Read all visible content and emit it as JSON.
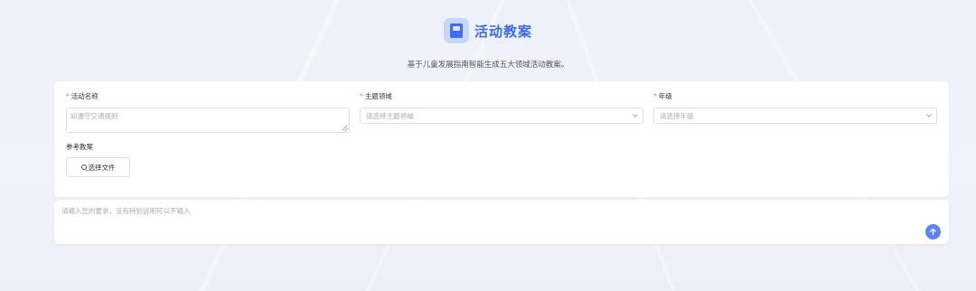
{
  "header": {
    "icon": "lesson-plan-icon",
    "title": "活动教案",
    "subtitle": "基于儿童发展指南智能生成五大领域活动教案。"
  },
  "form": {
    "activity_name": {
      "required": "*",
      "label": "活动名称",
      "placeholder": "如遵守交通规则"
    },
    "theme_domain": {
      "required": "*",
      "label": "主题领域",
      "placeholder": "请选择主题领域"
    },
    "grade": {
      "required": "*",
      "label": "年级",
      "placeholder": "请选择年级"
    },
    "reference": {
      "label": "参考教案",
      "button_label": "选择文件"
    }
  },
  "composer": {
    "placeholder": "请输入您的要求，没有特别说明可以不输入",
    "send_icon": "arrow-up-icon"
  },
  "colors": {
    "accent": "#3b6be8",
    "send_button": "#5b82ef",
    "required": "#f56c6c"
  }
}
